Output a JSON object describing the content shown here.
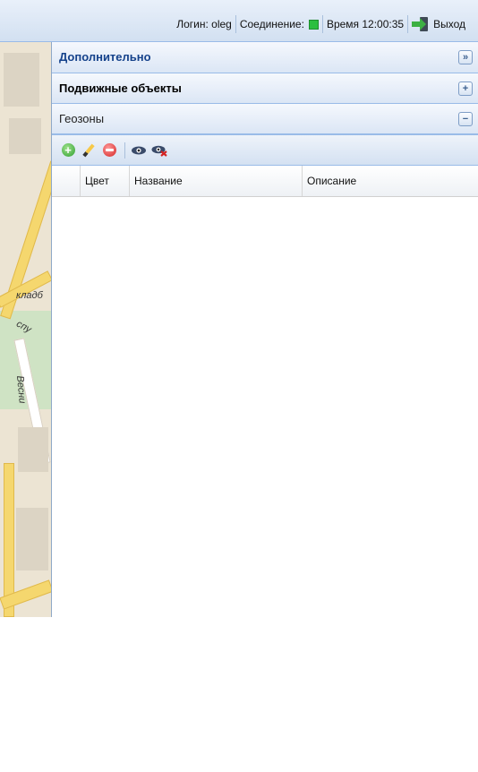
{
  "status_bar": {
    "login": "Логин: oleg",
    "connection_label": "Соединение:",
    "connection_color": "#2bbf3f",
    "time": "Время 12:00:35",
    "exit_label": "Выход",
    "exit_icon": "exit-door-icon"
  },
  "map": {
    "labels": [
      "кладб",
      "спу",
      "Весни"
    ]
  },
  "accordion": [
    {
      "title": "Дополнительно",
      "toggle": "»"
    },
    {
      "title": "Подвижные объекты",
      "toggle": "+"
    },
    {
      "title": "Геозоны",
      "toggle": "−"
    }
  ],
  "toolbar": {
    "icons": [
      "add-icon",
      "edit-icon",
      "delete-icon",
      "show-icon",
      "hide-icon"
    ]
  },
  "grid": {
    "columns": [
      "",
      "Цвет",
      "Название",
      "Описание"
    ],
    "rows": []
  },
  "colors": {
    "header_text": "#15428b",
    "border": "#99bbe8"
  }
}
